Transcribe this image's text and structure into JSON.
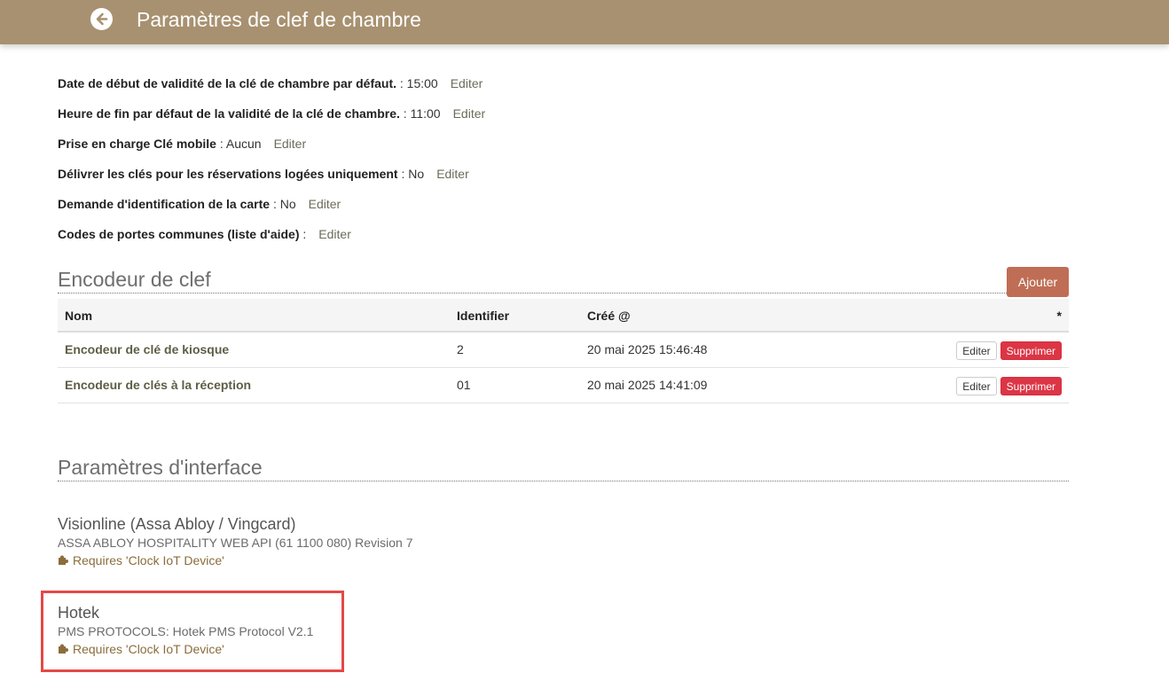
{
  "header": {
    "title": "Paramètres de clef de chambre",
    "back_icon": "back-circle-icon"
  },
  "settings": [
    {
      "label": "Date de début de validité de la clé de chambre par défaut.",
      "value": " : 15:00",
      "edit": "Editer"
    },
    {
      "label": "Heure de fin par défaut de la validité de la clé de chambre.",
      "value": " : 11:00",
      "edit": "Editer"
    },
    {
      "label": "Prise en charge Clé mobile",
      "value": " : Aucun",
      "edit": "Editer"
    },
    {
      "label": "Délivrer les clés pour les réservations logées uniquement",
      "value": " : No",
      "edit": "Editer"
    },
    {
      "label": "Demande d'identification de la carte",
      "value": " : No",
      "edit": "Editer"
    },
    {
      "label": "Codes de portes communes (liste d'aide)",
      "value": " :",
      "edit": "Editer"
    }
  ],
  "encoder": {
    "title": "Encodeur de clef",
    "add_label": "Ajouter",
    "columns": [
      "Nom",
      "Identifier",
      "Créé @",
      "*"
    ],
    "rows": [
      {
        "name": "Encodeur de clé de kiosque",
        "id": "2",
        "created": "20 mai 2025 15:46:48",
        "edit": "Editer",
        "delete": "Supprimer"
      },
      {
        "name": "Encodeur de clés à la réception",
        "id": "01",
        "created": "20 mai 2025 14:41:09",
        "edit": "Editer",
        "delete": "Supprimer"
      }
    ]
  },
  "interface": {
    "title": "Paramètres d'interface",
    "items": [
      {
        "name": "Visionline (Assa Abloy / Vingcard)",
        "desc": "ASSA ABLOY HOSPITALITY WEB API (61 1100 080) Revision 7",
        "requires": "Requires 'Clock IoT Device'",
        "icon": "puzzle-icon"
      },
      {
        "name": "Hotek",
        "desc": "PMS PROTOCOLS: Hotek PMS Protocol V2.1",
        "requires": "Requires 'Clock IoT Device'",
        "icon": "puzzle-icon"
      }
    ]
  },
  "colors": {
    "header_bg": "#a89170",
    "add_button": "#bf6e55",
    "delete_button": "#dc3545",
    "highlight": "#e54848"
  }
}
